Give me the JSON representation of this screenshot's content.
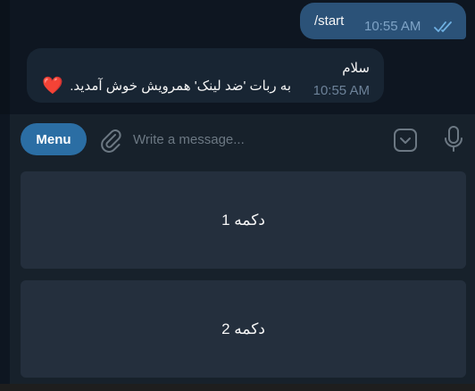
{
  "messages": {
    "outgoing": {
      "text": "/start",
      "time": "10:55 AM",
      "status_icon": "double-check-icon"
    },
    "incoming": {
      "line1": "سلام",
      "line2": "به ربات 'ضد لینک' همرویش خوش آمدید.",
      "emoji": "❤️",
      "time": "10:55 AM"
    }
  },
  "composer": {
    "menu_label": "Menu",
    "placeholder": "Write a message...",
    "icons": [
      "paperclip-icon",
      "sticker-icon",
      "microphone-icon"
    ]
  },
  "keyboard": {
    "buttons": [
      {
        "label": "دکمه 1"
      },
      {
        "label": "دکمه 2"
      }
    ]
  },
  "colors": {
    "background": "#0e1621",
    "panel": "#17212b",
    "outgoing_bubble": "#2b5278",
    "incoming_bubble": "#182533",
    "keyboard_button": "#242f3d",
    "accent": "#2b6ea4"
  }
}
